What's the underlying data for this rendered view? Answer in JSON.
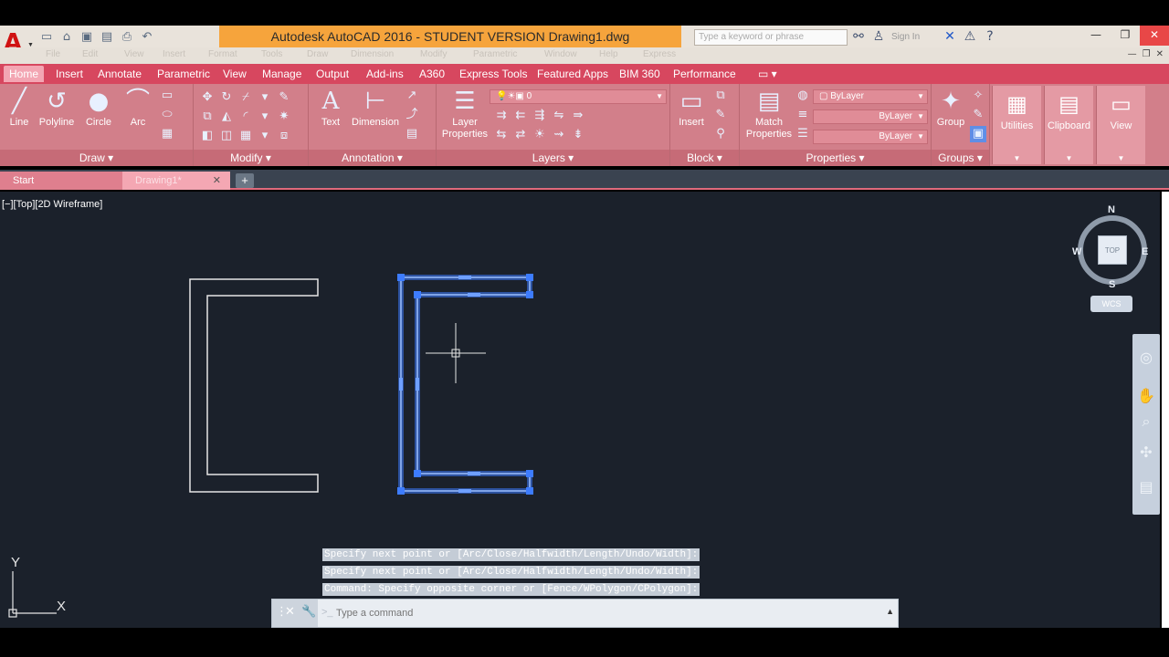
{
  "app": {
    "title": "Autodesk AutoCAD 2016 - STUDENT VERSION    Drawing1.dwg",
    "search_placeholder": "Type a keyword or phrase",
    "user_name": "Sign In",
    "logo": "A"
  },
  "menu": [
    "File",
    "Edit",
    "View",
    "Insert",
    "Format",
    "Tools",
    "Draw",
    "Dimension",
    "Modify",
    "Parametric",
    "Window",
    "Help",
    "Express"
  ],
  "ribbon_tabs": [
    "Home",
    "Insert",
    "Annotate",
    "Parametric",
    "View",
    "Manage",
    "Output",
    "Add-ins",
    "A360",
    "Express Tools",
    "Featured Apps",
    "BIM 360",
    "Performance"
  ],
  "ribbon": {
    "draw": {
      "title": "Draw",
      "tools": [
        "Line",
        "Polyline",
        "Circle",
        "Arc"
      ]
    },
    "modify": {
      "title": "Modify"
    },
    "annotation": {
      "title": "Annotation",
      "tools": [
        "Text",
        "Dimension"
      ]
    },
    "layers": {
      "title": "Layers",
      "tool": "Layer Properties",
      "current_layer": "0"
    },
    "block": {
      "title": "Block",
      "tool": "Insert"
    },
    "properties": {
      "title": "Properties",
      "tool": "Match Properties",
      "color": "ByLayer",
      "linetype": "ByLayer",
      "lineweight": "ByLayer"
    },
    "groups": {
      "title": "Groups",
      "tool": "Group"
    },
    "utilities": "Utilities",
    "clipboard": "Clipboard",
    "view": "View"
  },
  "file_tabs": {
    "start": "Start",
    "drawing": "Drawing1*"
  },
  "viewport": {
    "label": "[−][Top][2D Wireframe]",
    "viewcube_face": "TOP",
    "compass": {
      "n": "N",
      "s": "S",
      "e": "E",
      "w": "W"
    },
    "wcs": "WCS",
    "ucs_x": "X",
    "ucs_y": "Y"
  },
  "command": {
    "history": [
      "Specify next point or [Arc/Close/Halfwidth/Length/Undo/Width]:",
      "Specify next point or [Arc/Close/Halfwidth/Length/Undo/Width]:",
      "Command: Specify opposite corner or [Fence/WPolygon/CPolygon]:"
    ],
    "prompt": ">_",
    "placeholder": "Type a command"
  },
  "colors": {
    "ribbon_tab_bg": "#d7475f",
    "ribbon_bg": "#d27f8a",
    "title_highlight": "#f6a43c",
    "viewport_bg": "#1b212b",
    "selection_blue": "#3d7cff"
  }
}
